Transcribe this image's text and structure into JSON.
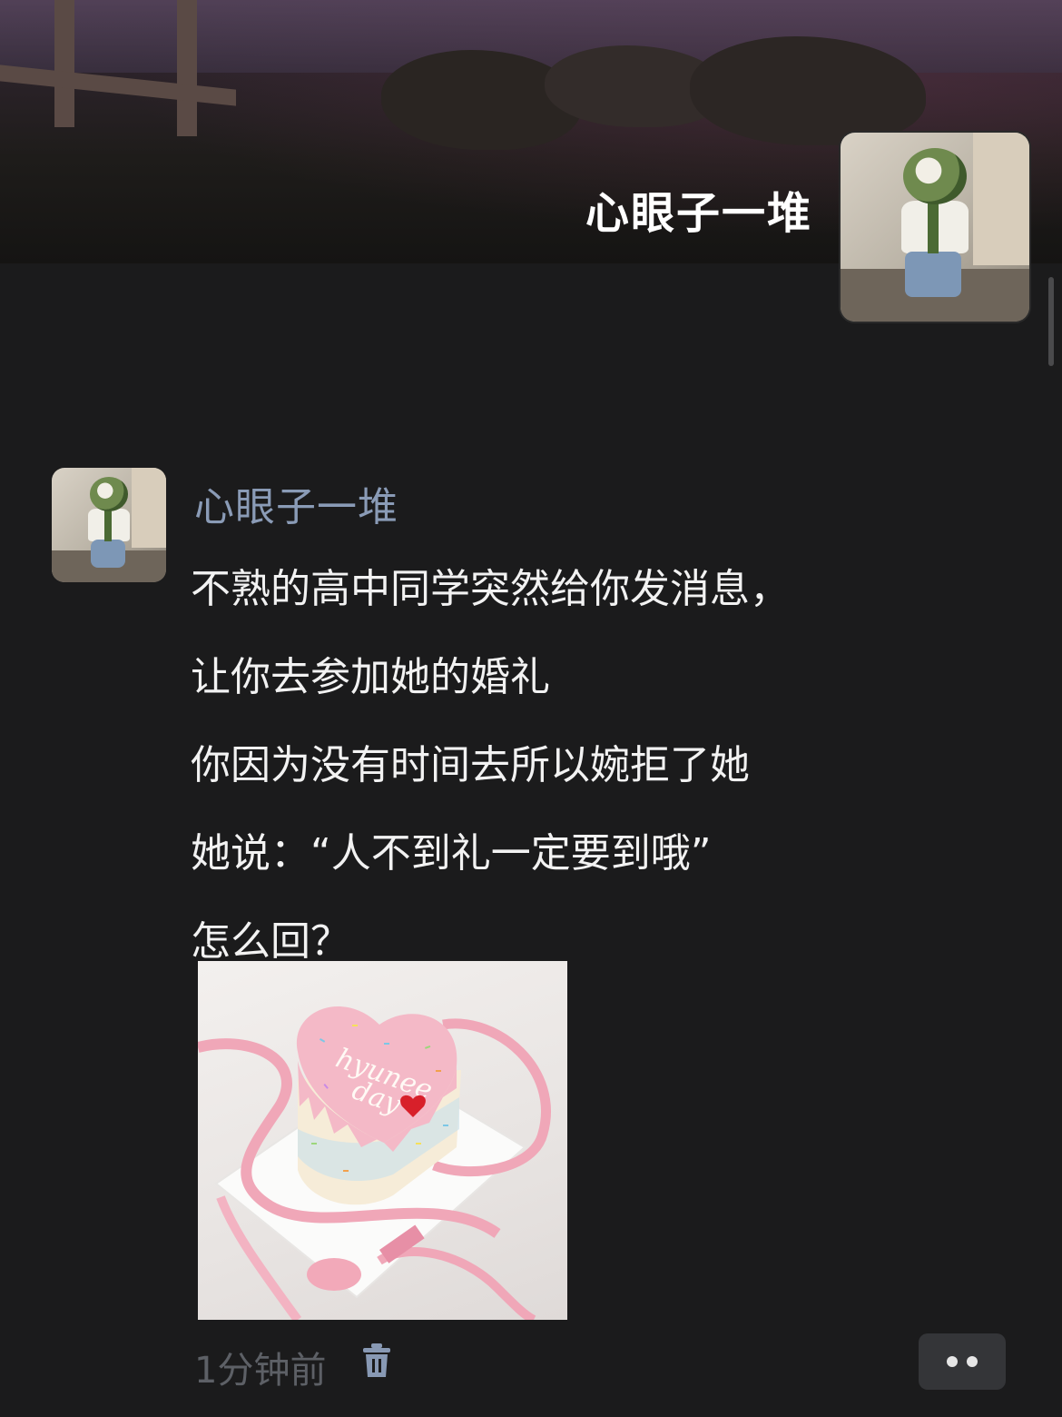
{
  "profile": {
    "title": "心眼子一堆"
  },
  "post": {
    "author": "心眼子一堆",
    "lines": [
      "不熟的高中同学突然给你发消息，",
      "让你去参加她的婚礼",
      "你因为没有时间去所以婉拒了她",
      "她说：“人不到礼一定要到哦”",
      "怎么回？"
    ],
    "image": {
      "cake_text_line1": "hyunee",
      "cake_text_line2": "day",
      "colors": {
        "cake_pink": "#f4b9c7",
        "ribbon_pink": "#f0a7b8",
        "heart_red": "#d8202a"
      }
    },
    "time": "1分钟前",
    "delete_icon": "trash-icon",
    "more_icon": "more-dots-icon"
  }
}
